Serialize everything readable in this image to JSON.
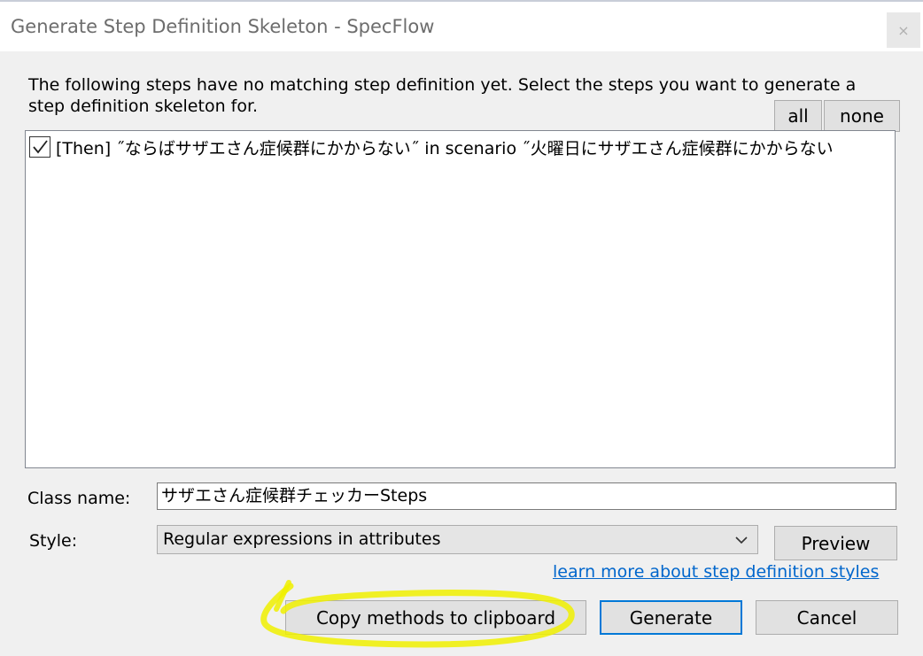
{
  "window": {
    "title": "Generate Step Definition Skeleton - SpecFlow",
    "close_icon": "×"
  },
  "instructions": "The following steps have no matching step definition yet. Select the steps you want to generate a step definition skeleton for.",
  "selection_buttons": {
    "all": "all",
    "none": "none"
  },
  "steps": [
    {
      "checked": true,
      "text": "[Then] ˝ならばサザエさん症候群にかからない˝ in scenario ˝火曜日にサザエさん症候群にかからない"
    }
  ],
  "class_name": {
    "label": "Class name:",
    "value": "サザエさん症候群チェッカーSteps"
  },
  "style": {
    "label": "Style:",
    "selected": "Regular expressions in attributes"
  },
  "preview_button": "Preview",
  "learn_more_link": "learn more about step definition styles",
  "footer_buttons": {
    "copy": "Copy methods to clipboard",
    "generate": "Generate",
    "cancel": "Cancel"
  },
  "colors": {
    "highlight": "#f0f000",
    "link": "#0066cc",
    "accent": "#0078d7"
  }
}
